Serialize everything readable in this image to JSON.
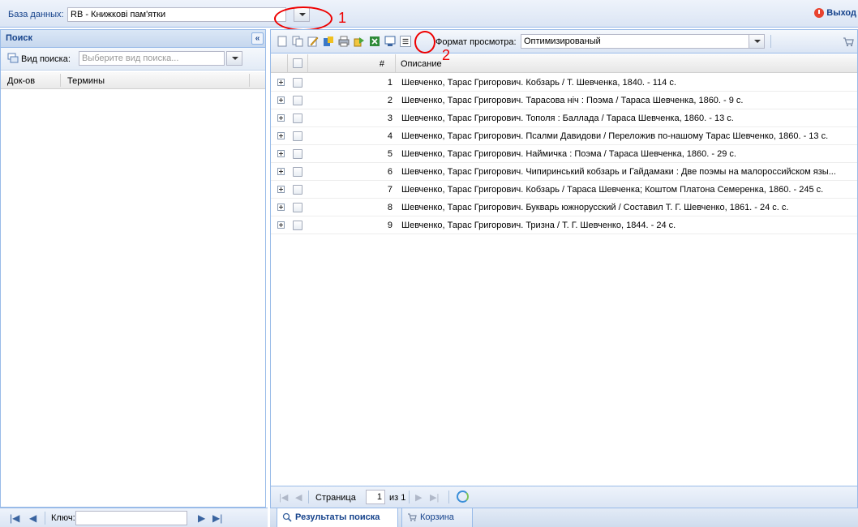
{
  "topbar": {
    "db_label": "База данных:",
    "db_value": "RB - Книжкові пам'ятки",
    "exit_label": "Выход"
  },
  "annotations": [
    "1",
    "2"
  ],
  "left_panel": {
    "title": "Поиск",
    "search_type_label": "Вид поиска:",
    "search_type_placeholder": "Выберите вид поиска...",
    "columns": [
      "Док-ов",
      "Термины"
    ],
    "key_label": "Ключ:"
  },
  "right_panel": {
    "format_label": "Формат просмотра:",
    "format_value": "Оптимизированый",
    "grid": {
      "col_num": "#",
      "col_desc": "Описание",
      "rows": [
        {
          "num": "1",
          "desc": "Шевченко, Тарас Григорович. Кобзарь / Т. Шевченка, 1840. - 114 с."
        },
        {
          "num": "2",
          "desc": "Шевченко, Тарас Григорович. Тарасова ніч : Поэма / Тараса Шевченка, 1860. - 9 с."
        },
        {
          "num": "3",
          "desc": "Шевченко, Тарас Григорович. Тополя : Баллада / Тараса Шевченка, 1860. - 13 с."
        },
        {
          "num": "4",
          "desc": "Шевченко, Тарас Григорович. Псалми Давидови / Переложив по-нашому Тарас Шевченко, 1860. - 13 с."
        },
        {
          "num": "5",
          "desc": "Шевченко, Тарас Григорович. Наймичка : Поэма / Тараса Шевченка, 1860. - 29 с."
        },
        {
          "num": "6",
          "desc": "Шевченко, Тарас Григорович. Чипиринський кобзарь и Гайдамаки : Две поэмы на малороссийском язы..."
        },
        {
          "num": "7",
          "desc": "Шевченко, Тарас Григорович. Кобзарь / Тараса Шевченка; Коштом Платона Семеренка, 1860. - 245 с."
        },
        {
          "num": "8",
          "desc": "Шевченко, Тарас Григорович. Букварь южнорусский / Составил Т. Г. Шевченко, 1861. - 24 с. с."
        },
        {
          "num": "9",
          "desc": "Шевченко, Тарас Григорович. Тризна / Т. Г. Шевченко, 1844. - 24 с."
        }
      ]
    },
    "pager": {
      "page_label": "Страница",
      "page_value": "1",
      "of_label": "из 1"
    }
  },
  "tabs": [
    {
      "label": "Результаты поиска",
      "active": true
    },
    {
      "label": "Корзина",
      "active": false
    }
  ],
  "colors": {
    "accent": "#15428b",
    "border": "#99bbe8",
    "annotation": "#e00000"
  }
}
